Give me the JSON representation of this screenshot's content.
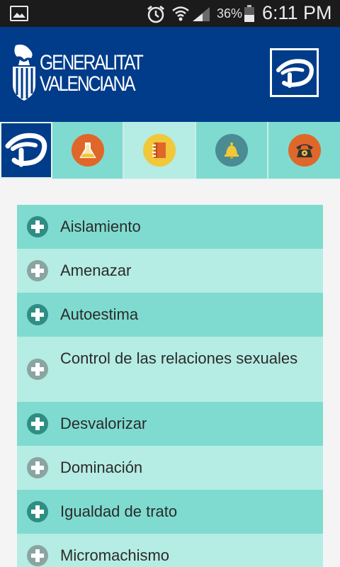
{
  "status_bar": {
    "battery_percent": "36%",
    "time": "6:11 PM",
    "icons": [
      "image-icon",
      "alarm-icon",
      "wifi-icon",
      "signal-icon",
      "battery-icon"
    ]
  },
  "header": {
    "logo_line1": "GENERALITAT",
    "logo_line2": "VALENCIANA",
    "colors": {
      "background": "#003c8a",
      "brand_box_border": "#ffffff"
    }
  },
  "tabs": [
    {
      "icon": "brand-logo-icon",
      "active": true
    },
    {
      "icon": "flask-icon",
      "active": false
    },
    {
      "icon": "notebook-icon",
      "active": false
    },
    {
      "icon": "bell-icon",
      "active": false
    },
    {
      "icon": "phone-icon",
      "active": false
    }
  ],
  "list": {
    "items": [
      {
        "label": "Aislamiento"
      },
      {
        "label": "Amenazar"
      },
      {
        "label": "Autoestima"
      },
      {
        "label": "Control de las relaciones sexuales"
      },
      {
        "label": "Desvalorizar"
      },
      {
        "label": "Dominación"
      },
      {
        "label": "Igualdad de trato"
      },
      {
        "label": "Micromachismo"
      }
    ],
    "colors": {
      "row_dark": "#7fdbcf",
      "row_light": "#b5ece3",
      "plus_dark": "#2e8e84",
      "plus_light": "#8aa5a1"
    }
  }
}
